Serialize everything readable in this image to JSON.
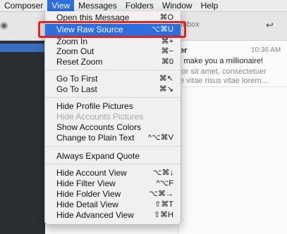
{
  "menubar": {
    "items": [
      "Composer",
      "View",
      "Messages",
      "Folders",
      "Window",
      "Help"
    ]
  },
  "background": {
    "toolbar_tab": "Inbox",
    "message": {
      "sender": "er",
      "time": "10:36 AM",
      "subject": "l make you a millionaire!",
      "preview_line1": "lor sit amet, consectetuer",
      "preview_line2": "e vitae risus vitae lorem..."
    }
  },
  "view_menu": {
    "items": [
      {
        "label": "Open this Message",
        "key": "⌘O"
      },
      {
        "label": "View Raw Source",
        "key": "⌥⌘U"
      },
      {
        "label": "Zoom In",
        "key": "⌘+"
      },
      {
        "label": "Zoom Out",
        "key": "⌘−"
      },
      {
        "label": "Reset Zoom",
        "key": "⌘0"
      },
      {
        "label": "Go To First",
        "key": "⌘↖"
      },
      {
        "label": "Go To Last",
        "key": "⌘↘"
      },
      {
        "label": "Hide Profile Pictures",
        "key": ""
      },
      {
        "label": "Hide Accounts Pictures",
        "key": ""
      },
      {
        "label": "Show Accounts Colors",
        "key": ""
      },
      {
        "label": "Change to Plain Text",
        "key": "^⌥⌘V"
      },
      {
        "label": "Always Expand Quote",
        "key": ""
      },
      {
        "label": "Hide Account View",
        "key": "⌥⌘↓"
      },
      {
        "label": "Hide Filter View",
        "key": "^⌥F"
      },
      {
        "label": "Hide Folder View",
        "key": "⌥⌘→"
      },
      {
        "label": "Hide Detail View",
        "key": "⇧⌘T"
      },
      {
        "label": "Hide Advanced View",
        "key": "⇧⌘H"
      }
    ]
  },
  "colors": {
    "highlight": "#2c6ee0",
    "annotation": "#e02420"
  }
}
